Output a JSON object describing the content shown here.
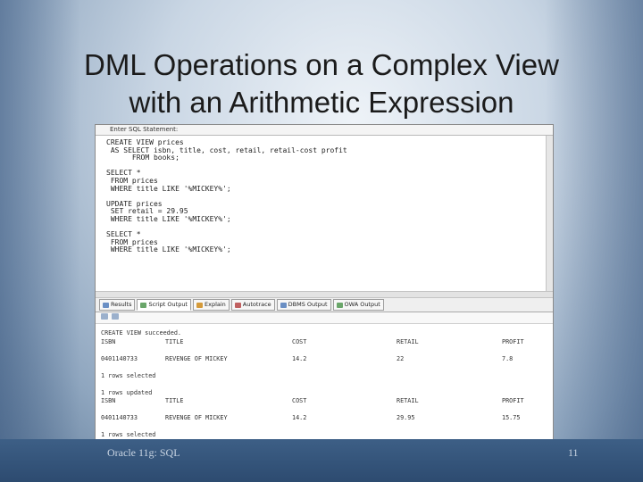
{
  "slide": {
    "title_line1": "DML Operations on a Complex View",
    "title_line2": "with an Arithmetic Expression",
    "footer_left": "Oracle 11g: SQL",
    "footer_right": "11"
  },
  "window": {
    "tab_label": "Enter SQL Statement:"
  },
  "editor": {
    "lines": [
      "CREATE VIEW prices",
      " AS SELECT isbn, title, cost, retail, retail-cost profit",
      "      FROM books;",
      "",
      "SELECT *",
      " FROM prices",
      " WHERE title LIKE '%MICKEY%';",
      "",
      "UPDATE prices",
      " SET retail = 29.95",
      " WHERE title LIKE '%MICKEY%';",
      "",
      "SELECT *",
      " FROM prices",
      " WHERE title LIKE '%MICKEY%';"
    ]
  },
  "output_tabs": [
    {
      "label": "Results",
      "icon": "results-icon"
    },
    {
      "label": "Script Output",
      "icon": "script-output-icon"
    },
    {
      "label": "Explain",
      "icon": "explain-icon"
    },
    {
      "label": "Autotrace",
      "icon": "autotrace-icon"
    },
    {
      "label": "DBMS Output",
      "icon": "dbms-output-icon"
    },
    {
      "label": "OWA Output",
      "icon": "owa-output-icon"
    }
  ],
  "output": {
    "line_created": "CREATE VIEW succeeded.",
    "header1": [
      "ISBN",
      "TITLE",
      "COST",
      "RETAIL",
      "PROFIT"
    ],
    "row1": [
      "0401140733",
      "REVENGE OF MICKEY",
      "14.2",
      "22",
      "7.8"
    ],
    "rows_selected1": "1 rows selected",
    "rows_updated": "1 rows updated",
    "header2": [
      "ISBN",
      "TITLE",
      "COST",
      "RETAIL",
      "PROFIT"
    ],
    "row2": [
      "0401140733",
      "REVENGE OF MICKEY",
      "14.2",
      "29.95",
      "15.75"
    ],
    "rows_selected2": "1 rows selected"
  }
}
